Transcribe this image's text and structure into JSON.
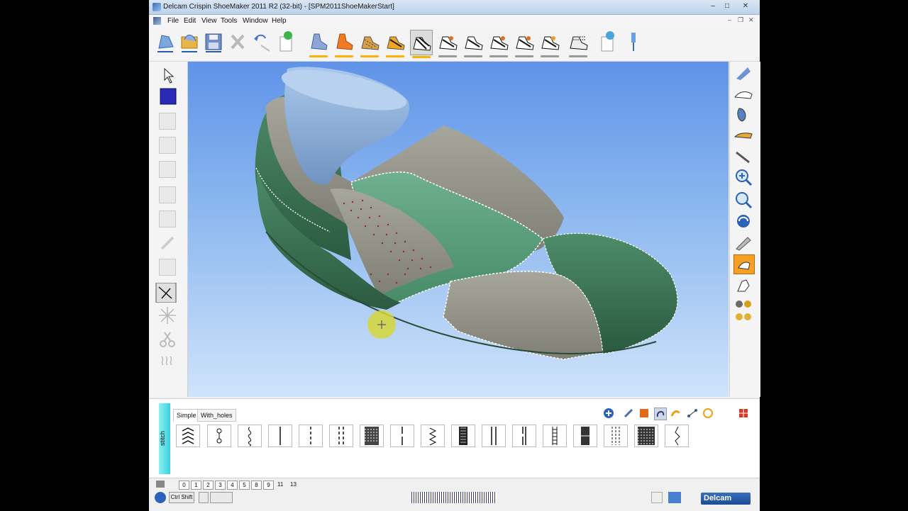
{
  "window": {
    "title": "Delcam Crispin ShoeMaker 2011 R2 (32-bit) - [SPM2011ShoeMakerStart]",
    "controls": [
      "minimize-icon",
      "maximize-icon",
      "close-icon"
    ]
  },
  "menu": {
    "items": [
      "File",
      "Edit",
      "View",
      "Tools",
      "Window",
      "Help"
    ]
  },
  "toolbar": {
    "buttons": [
      {
        "name": "open-last-icon"
      },
      {
        "name": "open-folder-icon"
      },
      {
        "name": "save-icon"
      },
      {
        "name": "delete-icon"
      },
      {
        "name": "undo-redo-icon"
      },
      {
        "name": "new-page-icon"
      },
      {
        "name": "last-shoe-icon",
        "bar": "#ffb000"
      },
      {
        "name": "shoe-orange-icon",
        "bar": "#ffb000"
      },
      {
        "name": "shoe-striped-icon",
        "bar": "#ffb000"
      },
      {
        "name": "shoe-orange-stripe-icon",
        "bar": "#ffb000"
      },
      {
        "name": "shoe-style-active-icon",
        "bar": "#ffb000"
      },
      {
        "name": "shoe-style-1-icon",
        "bar": "#999999"
      },
      {
        "name": "shoe-style-2-icon",
        "bar": "#999999"
      },
      {
        "name": "shoe-style-3-icon",
        "bar": "#999999"
      },
      {
        "name": "shoe-style-4-icon",
        "bar": "#999999"
      },
      {
        "name": "shoe-style-5-icon",
        "bar": "#999999"
      },
      {
        "name": "shoe-style-6-icon",
        "bar": "#999999"
      },
      {
        "name": "options-page-icon"
      },
      {
        "name": "pin-icon"
      }
    ]
  },
  "palette": {
    "side_label": "stitch",
    "tabs": [
      "Simple",
      "With_holes"
    ],
    "active_tab": "Simple",
    "tools": [
      "add-icon",
      "pen-icon",
      "hatch-icon",
      "lasso-icon",
      "brush-icon",
      "network-icon",
      "lock-icon",
      "grid-icon"
    ]
  },
  "statusbar": {
    "layer_tabs": [
      "0",
      "1",
      "2",
      "3",
      "4",
      "5",
      "8",
      "9"
    ],
    "layer_plain": [
      "11",
      "13"
    ],
    "modifier_label": "Ctrl Shift",
    "brand": "Delcam"
  },
  "colors": {
    "accent_orange": "#ffb000",
    "viewport_top": "#5f93e8",
    "shoe_green": "#3f7a57",
    "shoe_grey": "#8f8f86"
  }
}
